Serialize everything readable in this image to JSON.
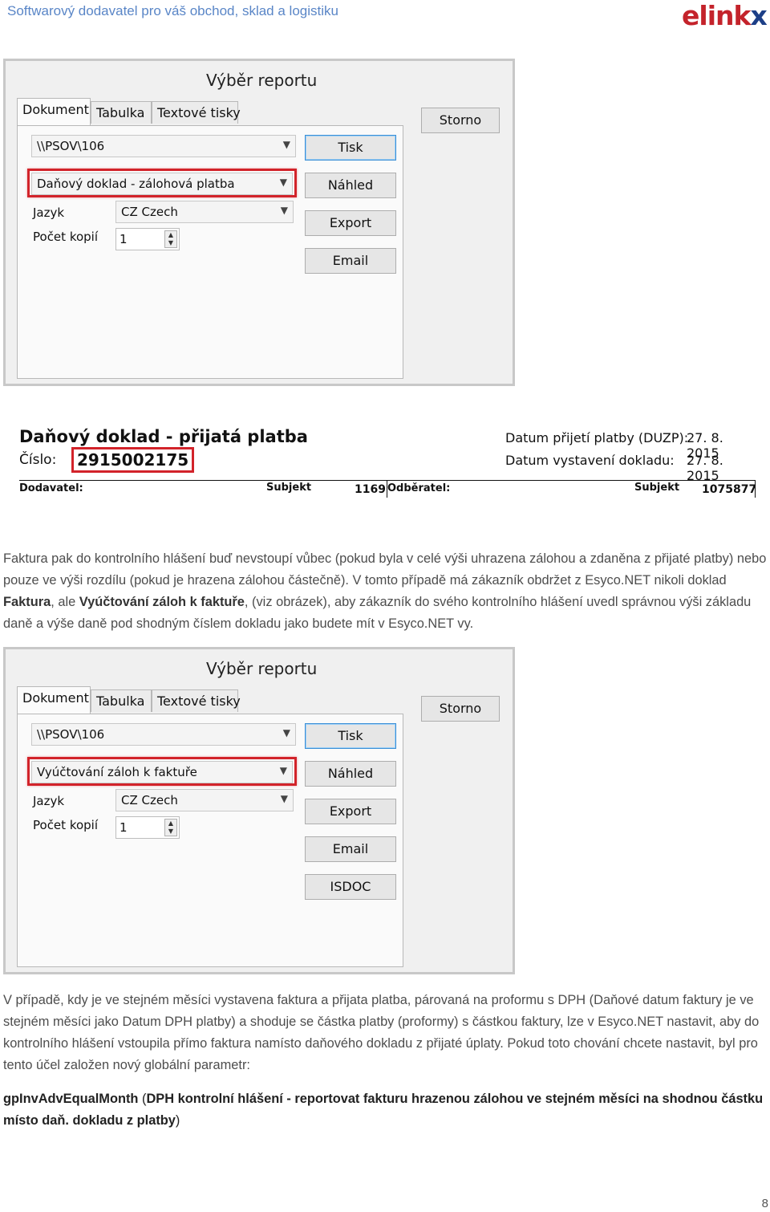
{
  "header": {
    "tagline": "Softwarový dodavatel pro váš obchod, sklad a logistiku",
    "logo_main": "elink",
    "logo_x": "x"
  },
  "dialog1": {
    "title": "Výběr reportu",
    "tabs": [
      "Dokument",
      "Tabulka",
      "Textové tisky"
    ],
    "printer": "\\\\PSOV\\106",
    "report": "Daňový doklad - zálohová platba",
    "language_label": "Jazyk",
    "language_value": "CZ  Czech",
    "copies_label": "Počet kopií",
    "copies_value": "1",
    "buttons": [
      "Storno",
      "Tisk",
      "Náhled",
      "Export",
      "Email"
    ]
  },
  "document": {
    "title": "Daňový doklad - přijatá platba",
    "number_label": "Číslo:",
    "number_value": "2915002175",
    "payment_date_label": "Datum přijetí platby (DUZP):",
    "payment_date_value": "27. 8. 2015",
    "issue_date_label": "Datum vystavení dokladu:",
    "issue_date_value": "27. 8. 2015",
    "supplier_label": "Dodavatel:",
    "supplier_subject_label": "Subjekt",
    "supplier_subject_value": "1169",
    "customer_label": "Odběratel:",
    "customer_subject_label": "Subjekt",
    "customer_subject_value": "1075877"
  },
  "paragraph1": {
    "p1": "Faktura pak do kontrolního hlášení buď nevstoupí vůbec (pokud byla v celé výši uhrazena zálohou a zdaněna z přijaté platby) nebo pouze ve výši rozdílu (pokud je hrazena zálohou částečně). V tomto případě má zákazník obdržet z Esyco.NET nikoli doklad ",
    "b1": "Faktura",
    "p2": ", ale ",
    "b2": "Vyúčtování záloh k faktuře",
    "p3": ", (viz obrázek), aby zákazník do svého kontrolního hlášení uvedl správnou výši základu daně a výše daně pod shodným číslem dokladu jako budete mít v Esyco.NET vy."
  },
  "dialog2": {
    "title": "Výběr reportu",
    "tabs": [
      "Dokument",
      "Tabulka",
      "Textové tisky"
    ],
    "printer": "\\\\PSOV\\106",
    "report": "Vyúčtování záloh k faktuře",
    "language_label": "Jazyk",
    "language_value": "CZ  Czech",
    "copies_label": "Počet kopií",
    "copies_value": "1",
    "buttons": [
      "Storno",
      "Tisk",
      "Náhled",
      "Export",
      "Email",
      "ISDOC"
    ]
  },
  "paragraph2": "V případě, kdy je ve stejném měsíci vystavena faktura a přijata platba, párovaná na proformu s DPH (Daňové datum faktury je ve stejném měsíci jako Datum DPH platby) a shoduje se částka platby (proformy) s částkou faktury, lze v Esyco.NET nastavit, aby do kontrolního hlášení vstoupila přímo faktura namísto daňového dokladu z přijaté úplaty. Pokud toto chování chcete nastavit, byl pro tento účel založen nový globální parametr:",
  "parameter": {
    "name": "gpInvAdvEqualMonth",
    "open": " (",
    "description": "DPH kontrolní hlášení - reportovat fakturu hrazenou zálohou ve stejném měsíci na shodnou částku místo daň. dokladu z platby",
    "close": ")"
  },
  "page_number": "8"
}
